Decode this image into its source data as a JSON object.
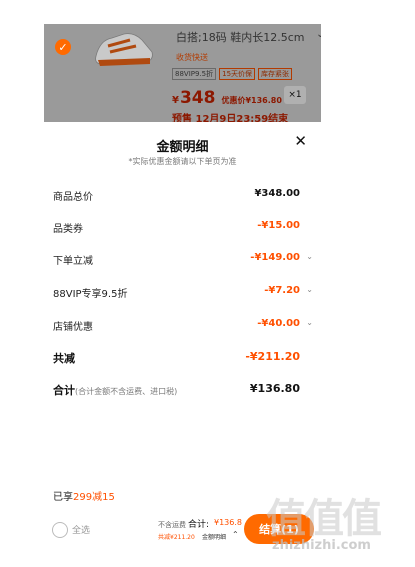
{
  "product": {
    "spec": "白搭;18码 鞋内长12.5cm",
    "hint": "收货快送",
    "tags": [
      "88VIP9.5折",
      "15天价保",
      "库存紧张"
    ],
    "currency": "¥",
    "price": "348",
    "after_label": "优惠价¥136.80",
    "qty": "×1",
    "presale": "预售 12月9日23:59结束"
  },
  "sheet": {
    "title": "金额明细",
    "subtitle": "*实际优惠金额请以下单页为准",
    "rows": [
      {
        "label": "商品总价",
        "value": "¥348.00"
      },
      {
        "label": "品类券",
        "value": "-¥15.00"
      },
      {
        "label": "下单立减",
        "value": "-¥149.00"
      },
      {
        "label": "88VIP专享9.5折",
        "value": "-¥7.20"
      },
      {
        "label": "店铺优惠",
        "value": "-¥40.00"
      },
      {
        "label": "共减",
        "value": "-¥211.20"
      },
      {
        "label": "合计",
        "note": "(合计金额不含运费、进口税)",
        "value": "¥136.80"
      }
    ],
    "enjoyed_prefix": "已享",
    "enjoyed_highlight": "299减15"
  },
  "bottom": {
    "select_all": "全选",
    "shipping_note": "不含运费",
    "total_label": "合计:",
    "total_value": "¥136.8",
    "saved": "共减¥211.20",
    "detail": "金额明细",
    "checkout": "结算(1)"
  },
  "watermark": {
    "chars": "值值值",
    "url": "zhizhizhi.com"
  },
  "colors": {
    "accent": "#ff5000",
    "button": "#ff6a00",
    "overlay": "#9a9a9a"
  }
}
